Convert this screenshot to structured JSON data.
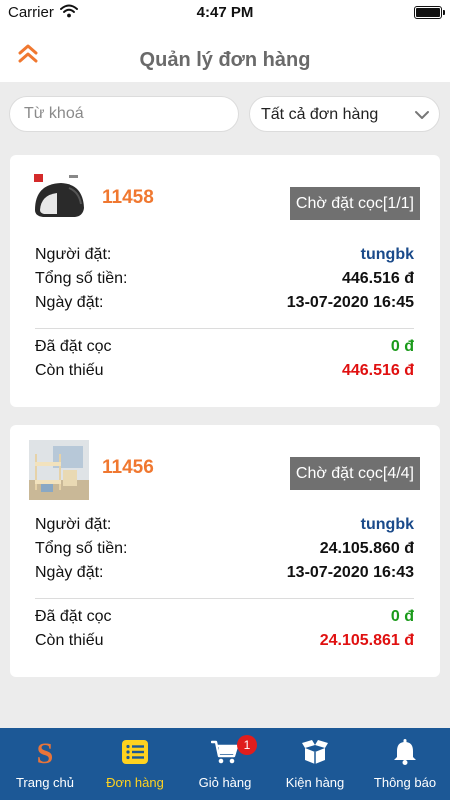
{
  "status_bar": {
    "carrier": "Carrier",
    "time": "4:47 PM"
  },
  "header": {
    "title": "Quản lý đơn hàng",
    "back_icon": "double-chevron-up-icon"
  },
  "filters": {
    "search_placeholder": "Từ khoá",
    "search_value": "",
    "status_selected": "Tất cả đơn hàng"
  },
  "labels": {
    "buyer": "Người đặt:",
    "total": "Tổng số tiền:",
    "date": "Ngày đặt:",
    "deposited": "Đã đặt cọc",
    "remaining": "Còn thiếu"
  },
  "orders": [
    {
      "id": "11458",
      "status": "Chờ đặt cọc[1/1]",
      "buyer": "tungbk",
      "total": "446.516 đ",
      "date": "13-07-2020 16:45",
      "deposited": "0 đ",
      "remaining": "446.516 đ",
      "thumbnail": "helmet"
    },
    {
      "id": "11456",
      "status": "Chờ đặt cọc[4/4]",
      "buyer": "tungbk",
      "total": "24.105.860 đ",
      "date": "13-07-2020 16:43",
      "deposited": "0 đ",
      "remaining": "24.105.861 đ",
      "thumbnail": "bunk-bed"
    }
  ],
  "tabbar": {
    "items": [
      {
        "label": "Trang chủ",
        "icon": "brand-s-icon"
      },
      {
        "label": "Đơn hàng",
        "icon": "list-icon",
        "active": true
      },
      {
        "label": "Giỏ hàng",
        "icon": "cart-icon",
        "badge": "1"
      },
      {
        "label": "Kiện hàng",
        "icon": "package-icon"
      },
      {
        "label": "Thông báo",
        "icon": "bell-icon"
      }
    ]
  },
  "colors": {
    "accent": "#f07830",
    "tabbar_bg": "#1c5896",
    "tab_active": "#ffd21f",
    "status_badge_bg": "#707070",
    "buyer_text": "#1a4a8a",
    "deposit_text": "#1a9a1a",
    "remaining_text": "#e01010"
  }
}
